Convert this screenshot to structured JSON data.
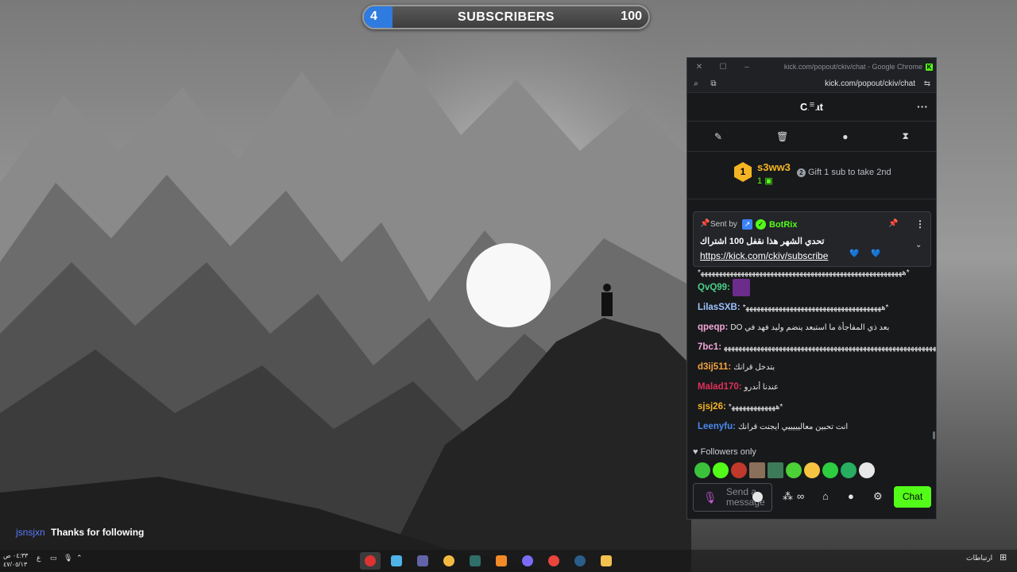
{
  "goal": {
    "current": "4",
    "title": "SUBSCRIBERS",
    "target": "100",
    "progress_fraction": 0.04,
    "fill_color": "#2f7be0"
  },
  "browser": {
    "title": "kick.com/popout/ckiv/chat - Google Chrome",
    "url": "kick.com/popout/ckiv/chat"
  },
  "chat": {
    "header": "Chat",
    "accent_color": "#53fc18",
    "mod_tools": [
      "broom-icon",
      "trash-icon",
      "chat-bubble-icon",
      "hourglass-icon"
    ],
    "leaderboard": {
      "rank": "1",
      "name": "s3ww3",
      "gifts": "1",
      "next_rank": "2",
      "next_label": "Gift 1 sub to take 2nd"
    },
    "pinned": {
      "sent_by": "Sent by",
      "user": "BotRix",
      "text": "تحدي الشهر هذا نقفل 100 اشتراك",
      "link": "https://kick.com/ckiv/subscribe",
      "partial": "*ه‍ه‍ه‍ه‍ه‍ه‍ه‍ه‍ه‍ه‍ه‍ه‍ه‍ه‍ه‍ه‍ه‍ه‍ه‍ه‍ه‍ه‍ه‍ه‍ه‍ه‍ه‍ه‍ه‍ه‍ه‍ه‍ه‍ه‍ه‍ه‍ه‍ه‍ه‍ه‍ه‍ه‍ه‍ه‍ه‍ه‍ه‍ه‍ه‍ه‍ه‍ه‍ه‍ه‍ه‍ه‍*"
    },
    "messages": [
      {
        "user": "QvQ99:",
        "color": "#4ad18a",
        "text": ""
      },
      {
        "user": "LilasSXB:",
        "color": "#9ec3ff",
        "text": "*ه‍ه‍ه‍ه‍ه‍ه‍ه‍ه‍ه‍ه‍ه‍ه‍ه‍ه‍ه‍ه‍ه‍ه‍ه‍ه‍ه‍ه‍ه‍ه‍ه‍ه‍ه‍ه‍ه‍ه‍ه‍ه‍ه‍ه‍ه‍ه‍ه‍ه‍*"
      },
      {
        "user": "qpeqp:",
        "color": "#f1a7d7",
        "text": "DO بعد ذي المفاجأة ما استبعد ينضم وليد فهد في"
      },
      {
        "user": "7bc1:",
        "color": "#f1a7d7",
        "text": "بدايه الطنيان *ه‍ه‍ه‍ه‍ه‍ه‍ه‍ه‍ه‍ه‍ه‍ه‍ه‍ه‍ه‍ه‍ه‍ه‍ه‍ه‍ه‍ه‍ه‍ه‍ه‍ه‍ه‍ه‍ه‍ه‍ه‍ه‍ه‍ه‍ه‍ه‍ه‍ه‍ه‍ه‍ه‍ه‍ه‍ه‍ه‍ه‍ه‍ه‍ه‍ه‍ه‍ه‍ه‍ه‍ه‍ه‍ه‍ه‍ه‍ه‍ه‍ه‍ه‍ه‍ه‍ه‍ه‍ه‍ه‍ه‍ه‍ه‍*"
      },
      {
        "user": "d3ij511:",
        "color": "#f4a340",
        "text": "بتدخل قرانك"
      },
      {
        "user": "Malad170:",
        "color": "#e0305a",
        "text": "عندنا أندرو"
      },
      {
        "user": "sjsj26:",
        "color": "#f4b524",
        "text": "*ه‍ه‍ه‍ه‍ه‍ه‍ه‍ه‍ه‍ه‍ه‍ه‍ه‍*"
      },
      {
        "user": "Leenyfu:",
        "color": "#4a8cf0",
        "text": "انت تحبين معاليييييي ايجنت قرانك"
      }
    ],
    "followers_only": "Followers only",
    "input_placeholder": "Send a message",
    "send_label": "Chat"
  },
  "notification": {
    "user": "jsnsjxn",
    "text": "Thanks for following"
  },
  "taskbar": {
    "clock_time": "٠٤:٣٣ ص",
    "clock_date": "٤٧/٠٥/١٣",
    "lang": "ع",
    "network_label": "ارتباطات",
    "apps": [
      "obs-icon",
      "notepad-icon",
      "teams-icon",
      "discord-icon",
      "xbox-icon",
      "aim-icon",
      "app-icon",
      "chrome-icon",
      "steam-icon",
      "folder-icon"
    ]
  }
}
